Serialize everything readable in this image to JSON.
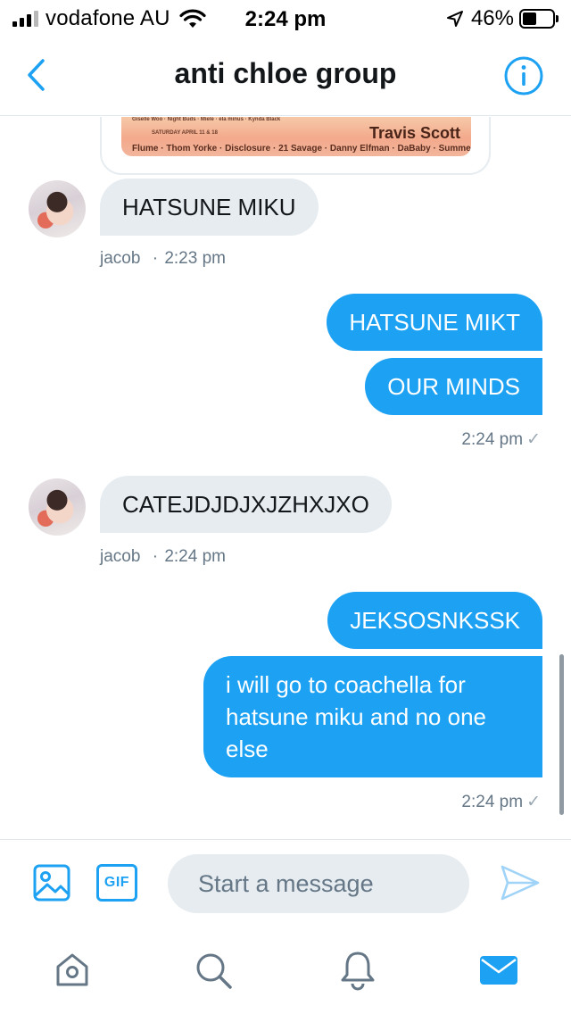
{
  "status_bar": {
    "carrier": "vodafone AU",
    "time": "2:24 pm",
    "battery_percent": "46%",
    "battery_level": 0.46,
    "signal_bars": 3
  },
  "header": {
    "title": "anti chloe group",
    "back_icon": "chevron-left-icon",
    "info_icon": "info-circle-icon"
  },
  "shared_image": {
    "row1": "Giselle Woo · Night Buds · Miele · ela minus · Kynda Black",
    "row2": "SATURDAY APRIL 11 & 18",
    "headliner": "Travis Scott",
    "row3": "Flume · Thom Yorke · Disclosure · 21 Savage · Danny Elfman · DaBaby · Summer Walker"
  },
  "messages": [
    {
      "id": "m1",
      "direction": "in",
      "text": "HATSUNE MIKU"
    },
    {
      "id": "m2",
      "direction": "out",
      "text": "HATSUNE MIKT"
    },
    {
      "id": "m3",
      "direction": "out",
      "text": "OUR MINDS"
    },
    {
      "id": "m4",
      "direction": "in",
      "text": "CATEJDJDJXJZHXJXO"
    },
    {
      "id": "m5",
      "direction": "out",
      "text": "JEKSOSNKSSK"
    },
    {
      "id": "m6",
      "direction": "out",
      "text": "i will go to coachella for hatsune miku and no one else"
    }
  ],
  "meta": {
    "m1": {
      "sender": "jacob",
      "separator": "·",
      "time": "2:23 pm"
    },
    "m3": {
      "time": "2:24 pm",
      "status": "✓"
    },
    "m4": {
      "sender": "jacob",
      "separator": "·",
      "time": "2:24 pm"
    },
    "m6": {
      "time": "2:24 pm",
      "status": "✓"
    }
  },
  "compose": {
    "placeholder": "Start a message",
    "value": "",
    "gif_label": "GIF",
    "image_icon": "image-icon",
    "send_icon": "send-icon"
  },
  "tabs": [
    {
      "name": "home",
      "icon": "home-icon",
      "active": false
    },
    {
      "name": "search",
      "icon": "search-icon",
      "active": false
    },
    {
      "name": "notifications",
      "icon": "bell-icon",
      "active": false
    },
    {
      "name": "messages",
      "icon": "mail-icon",
      "active": true
    }
  ],
  "colors": {
    "accent": "#1da1f2",
    "incoming_bubble": "#e6ecf0",
    "secondary_text": "#657786"
  }
}
